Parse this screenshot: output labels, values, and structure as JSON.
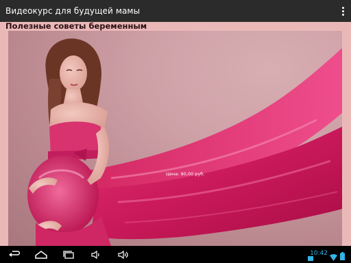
{
  "app": {
    "title": "Видеокурс для будущей мамы",
    "menu_icon": "overflow-menu-icon"
  },
  "content": {
    "heading": "Полезные советы беременным",
    "price_label": "Цена: 90,00 руб.",
    "background_color": "#ebb8b8",
    "photo": "pregnant-woman-in-pink-dress-photo"
  },
  "navbar": {
    "buttons": [
      "back-icon",
      "home-icon",
      "recent-apps-icon",
      "volume-down-icon",
      "volume-up-icon"
    ],
    "time": "10:42",
    "status_icons": [
      "notification-icon",
      "wifi-icon",
      "battery-icon"
    ],
    "accent_color": "#33b5e5"
  }
}
